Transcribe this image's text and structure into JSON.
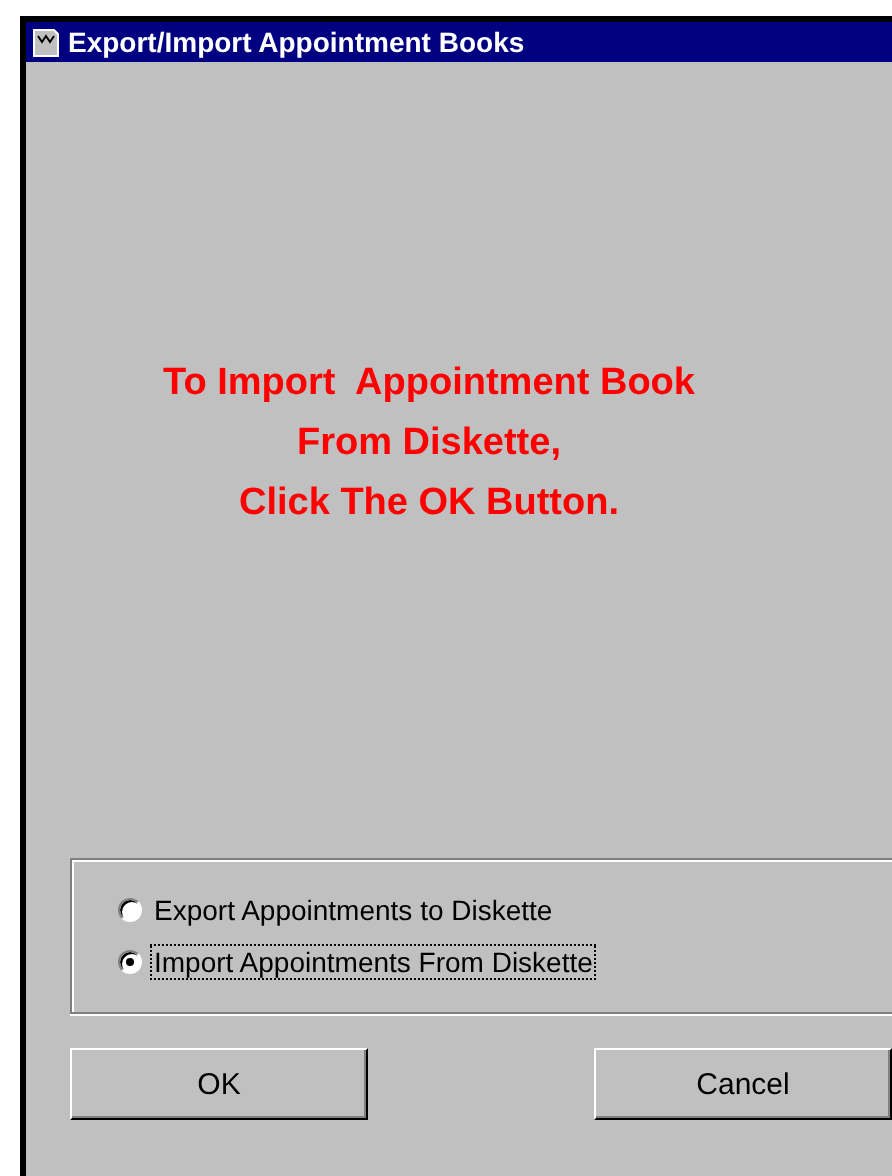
{
  "window": {
    "title": "Export/Import Appointment Books"
  },
  "message": {
    "lines": [
      "To Import  Appointment Book",
      "From Diskette,",
      "Click The OK Button."
    ]
  },
  "options": [
    {
      "label": "Export Appointments to Diskette",
      "selected": false,
      "focused": false
    },
    {
      "label": "Import Appointments From Diskette",
      "selected": true,
      "focused": true
    }
  ],
  "buttons": [
    {
      "label": "OK"
    },
    {
      "label": "Cancel"
    }
  ]
}
